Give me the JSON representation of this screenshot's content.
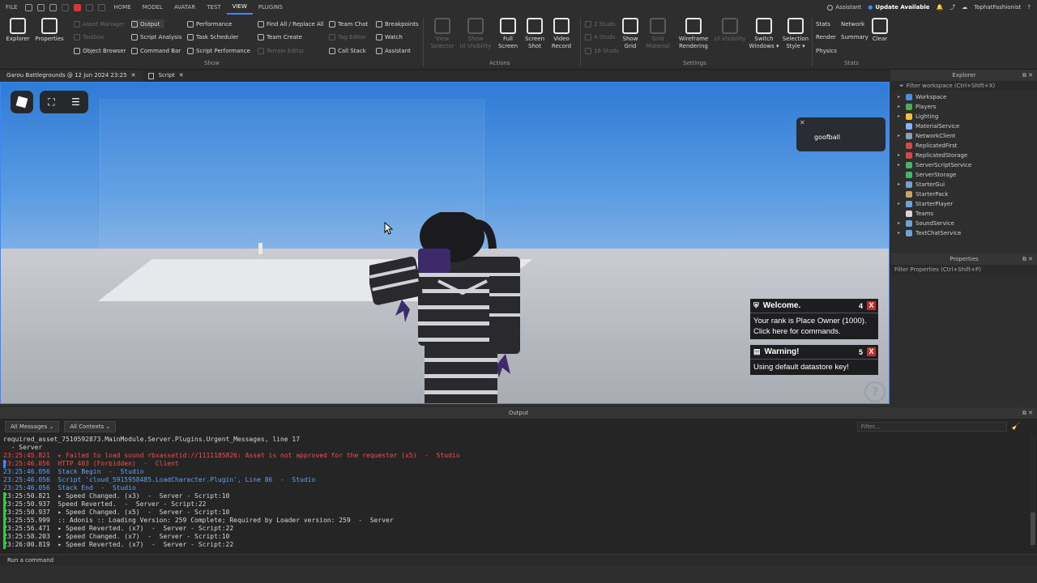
{
  "menubar": {
    "file": "FILE",
    "tabs": [
      "HOME",
      "MODEL",
      "AVATAR",
      "TEST",
      "VIEW",
      "PLUGINS"
    ],
    "active_tab": "VIEW",
    "assistant": "Assistant",
    "update": "Update Available",
    "user": "TophatFashionist"
  },
  "ribbon": {
    "explorer": "Explorer",
    "properties": "Properties",
    "asset_manager": "Asset Manager",
    "toolbox": "Toolbox",
    "object_browser": "Object Browser",
    "output": "Output",
    "script_analysis": "Script Analysis",
    "command_bar": "Command Bar",
    "performance": "Performance",
    "task_scheduler": "Task Scheduler",
    "script_performance": "Script Performance",
    "find_all": "Find All / Replace All",
    "team_create": "Team Create",
    "terrain_editor": "Terrain Editor",
    "team_chat": "Team Chat",
    "tag_editor": "Tag Editor",
    "call_stack": "Call Stack",
    "breakpoints": "Breakpoints",
    "watch": "Watch",
    "assistant": "Assistant",
    "show_group": "Show",
    "view_selector_1": "View",
    "view_selector_2": "Selector",
    "show_grid_1": "Show",
    "show_grid_2": "Grid",
    "ui_visibility_1": "UI Visibility",
    "full_screen_1": "Full",
    "full_screen_2": "Screen",
    "screen_shot_1": "Screen",
    "screen_shot_2": "Shot",
    "video_record_1": "Video",
    "video_record_2": "Record",
    "actions_group": "Actions",
    "studs_2": "2 Studs",
    "studs_4": "4 Studs",
    "studs_16": "16 Studs",
    "grid_1": "Show",
    "grid_2": "Grid",
    "grid_material_1": "Grid",
    "grid_material_2": "Material",
    "wireframe_1": "Wireframe",
    "wireframe_2": "Rendering",
    "settings_group": "Settings",
    "switch_windows_1": "Switch",
    "switch_windows_2": "Windows ▾",
    "selection_style_1": "Selection",
    "selection_style_2": "Style ▾",
    "stats": "Stats",
    "network": "Network",
    "render": "Render",
    "summary": "Summary",
    "physics": "Physics",
    "clear": "Clear",
    "stats_group": "Stats"
  },
  "doc_tabs": [
    {
      "label": "Garou Battlegrounds @ 12 Jun 2024 23:25"
    },
    {
      "label": "Script"
    }
  ],
  "viewport": {
    "goofball": "goofball",
    "welcome_title": "Welcome.",
    "welcome_count": "4",
    "welcome_body": "Your rank is Place Owner (1000). Click here for commands.",
    "warning_title": "Warning!",
    "warning_count": "5",
    "warning_body": "Using default datastore key!",
    "close": "X",
    "help": "?"
  },
  "explorer": {
    "title": "Explorer",
    "filter": "Filter workspace (Ctrl+Shift+X)",
    "items": [
      {
        "label": "Workspace",
        "color": "#4a90e2",
        "arrow": "▸"
      },
      {
        "label": "Players",
        "color": "#4caf50",
        "arrow": "▸"
      },
      {
        "label": "Lighting",
        "color": "#f2c230",
        "arrow": "▸"
      },
      {
        "label": "MaterialService",
        "color": "#7fb7ff",
        "arrow": ""
      },
      {
        "label": "NetworkClient",
        "color": "#8aa0b8",
        "arrow": "▸"
      },
      {
        "label": "ReplicatedFirst",
        "color": "#d14a4a",
        "arrow": ""
      },
      {
        "label": "ReplicatedStorage",
        "color": "#d14a4a",
        "arrow": "▸"
      },
      {
        "label": "ServerScriptService",
        "color": "#4ab36a",
        "arrow": "▸"
      },
      {
        "label": "ServerStorage",
        "color": "#4ab36a",
        "arrow": ""
      },
      {
        "label": "StarterGui",
        "color": "#6fa3d8",
        "arrow": "▸"
      },
      {
        "label": "StarterPack",
        "color": "#c9a46a",
        "arrow": ""
      },
      {
        "label": "StarterPlayer",
        "color": "#6fa3d8",
        "arrow": "▸"
      },
      {
        "label": "Teams",
        "color": "#d8d8d8",
        "arrow": ""
      },
      {
        "label": "SoundService",
        "color": "#6fa3d8",
        "arrow": "▸"
      },
      {
        "label": "TextChatService",
        "color": "#6fa3d8",
        "arrow": "▸"
      }
    ]
  },
  "properties": {
    "title": "Properties",
    "filter": "Filter Properties (Ctrl+Shift+P)"
  },
  "output": {
    "title": "Output",
    "messages_filter": "All Messages",
    "contexts_filter": "All Contexts",
    "search_placeholder": "Filter...",
    "lines": [
      {
        "text": "required_asset_7510592873.MainModule.Server.Plugins.Urgent_Messages, line 17",
        "kind": "normal",
        "bar": ""
      },
      {
        "text": "  - Server",
        "kind": "normal",
        "bar": ""
      },
      {
        "text": "23:25:45.821  ▸ Failed to load sound rbxassetid://1111185826: Asset is not approved for the requester (x5)  -  Studio",
        "kind": "err",
        "bar": ""
      },
      {
        "text": "23:25:46.056  HTTP 403 (Forbidden)  -  Client",
        "kind": "mixed1",
        "bar": "#3a88ff"
      },
      {
        "text": "23:25:46.056  Stack Begin  -  Studio",
        "kind": "mixed2",
        "bar": ""
      },
      {
        "text": "23:25:46.056  Script 'cloud_5915958485.LoadCharacter.Plugin', Line 86  -  Studio",
        "kind": "mixed2",
        "bar": ""
      },
      {
        "text": "23:25:46.056  Stack End  -  Studio",
        "kind": "mixed2",
        "bar": ""
      },
      {
        "text": "23:25:50.821  ▸ Speed Changed. (x3)  -  Server - Script:10",
        "kind": "normal",
        "bar": "#2ecc40"
      },
      {
        "text": "23:25:50.937  Speed Reverted.  -  Server - Script:22",
        "kind": "normal",
        "bar": "#2ecc40"
      },
      {
        "text": "23:25:50.937  ▸ Speed Changed. (x5)  -  Server - Script:10",
        "kind": "normal",
        "bar": "#2ecc40"
      },
      {
        "text": "23:25:55.999  :: Adonis :: Loading Version: 259 Complete; Required by Loader version: 259  -  Server",
        "kind": "normal",
        "bar": "#2ecc40"
      },
      {
        "text": "23:25:56.471  ▸ Speed Reverted. (x7)  -  Server - Script:22",
        "kind": "normal",
        "bar": "#2ecc40"
      },
      {
        "text": "23:25:58.203  ▸ Speed Changed. (x7)  -  Server - Script:10",
        "kind": "normal",
        "bar": "#2ecc40"
      },
      {
        "text": "23:26:00.819  ▸ Speed Reverted. (x7)  -  Server - Script:22",
        "kind": "normal",
        "bar": "#2ecc40"
      }
    ]
  },
  "command_bar": {
    "placeholder": "Run a command"
  }
}
